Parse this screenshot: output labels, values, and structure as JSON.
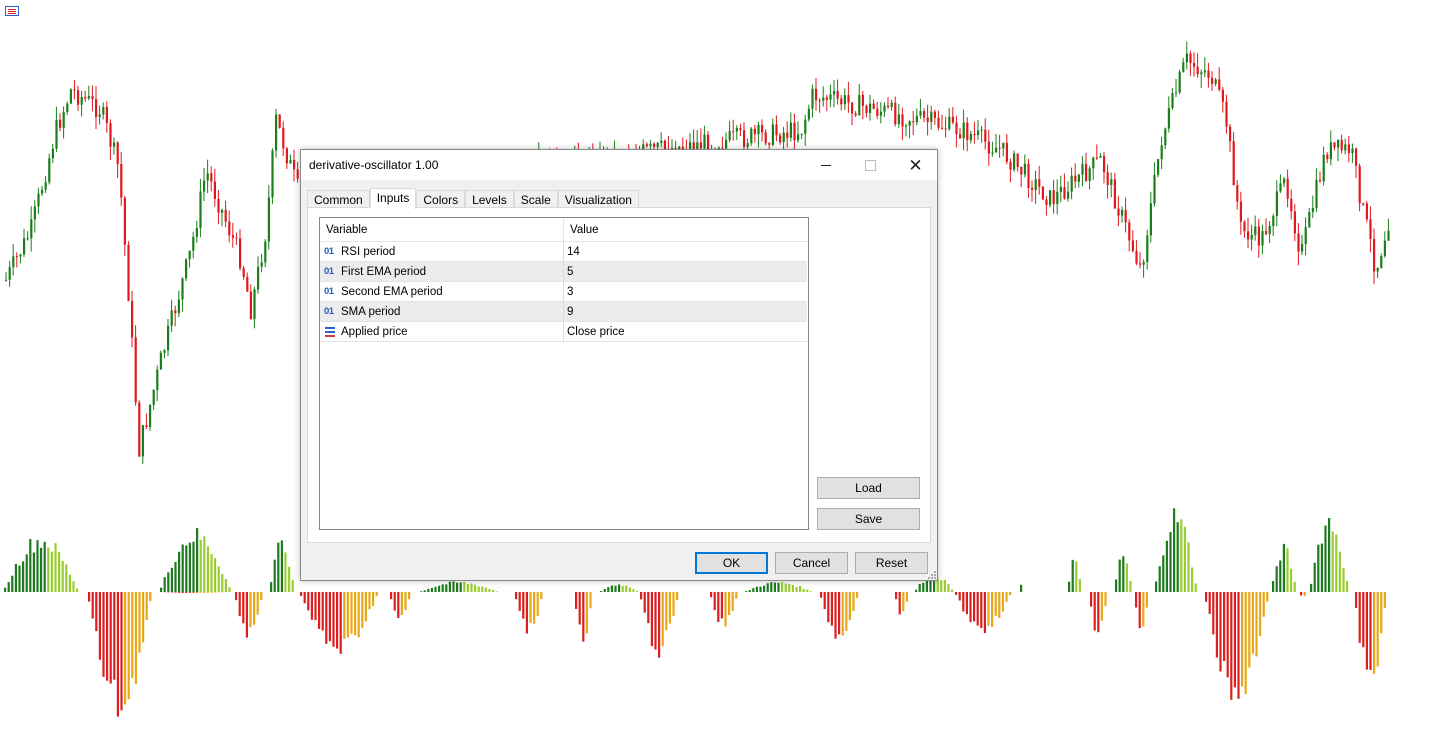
{
  "dialog": {
    "title": "derivative-oscillator 1.00",
    "tabs": [
      {
        "label": "Common",
        "active": false
      },
      {
        "label": "Inputs",
        "active": true
      },
      {
        "label": "Colors",
        "active": false
      },
      {
        "label": "Levels",
        "active": false
      },
      {
        "label": "Scale",
        "active": false
      },
      {
        "label": "Visualization",
        "active": false
      }
    ],
    "grid": {
      "columns": [
        "Variable",
        "Value"
      ],
      "rows": [
        {
          "icon": "integer-input-icon",
          "glyph": "01",
          "variable": "RSI period",
          "value": "14"
        },
        {
          "icon": "integer-input-icon",
          "glyph": "01",
          "variable": "First EMA period",
          "value": "5"
        },
        {
          "icon": "integer-input-icon",
          "glyph": "01",
          "variable": "Second EMA period",
          "value": "3"
        },
        {
          "icon": "integer-input-icon",
          "glyph": "01",
          "variable": "SMA period",
          "value": "9"
        },
        {
          "icon": "enum-list-icon",
          "glyph": "",
          "variable": "Applied price",
          "value": "Close price"
        }
      ]
    },
    "buttons": {
      "load": "Load",
      "save": "Save",
      "ok": "OK",
      "cancel": "Cancel",
      "reset": "Reset"
    }
  },
  "colors": {
    "bull_candle": "#1a7f1a",
    "bear_candle": "#e0191e",
    "hist_dark_green": "#1e7a1e",
    "hist_light_green": "#9acd32",
    "hist_red": "#dc1e1e",
    "hist_orange": "#e8a817",
    "ok_border": "#0078d7"
  }
}
